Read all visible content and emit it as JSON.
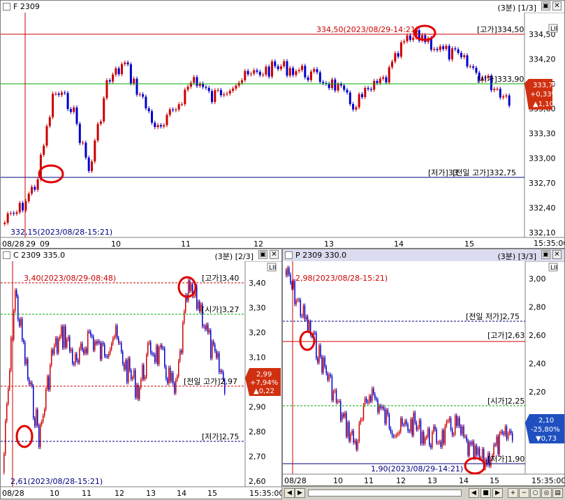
{
  "panels": {
    "F": {
      "title": "F 2309",
      "timeframe": "(3분)",
      "page": "[1/3]",
      "yticks": [
        "334,50",
        "334,20",
        "333,90",
        "333,60",
        "333,30",
        "333,00",
        "332,70",
        "332,40",
        "332,10"
      ],
      "xticks": [
        "08/28",
        "29",
        "09",
        "10",
        "11",
        "12",
        "13",
        "14",
        "15"
      ],
      "time": "15:35:00",
      "high_note": "334,50(2023/08/29-14:21)",
      "low_note": "332,15(2023/08/28-15:21)",
      "hline_high": "[고가]334,50",
      "hline_open": "[시가]333,90",
      "hline_low": "[저가]33",
      "hline_prev": "[전일 고가]332,75",
      "price_tag": [
        "333,75",
        "+0,33%",
        "▲1,10"
      ]
    },
    "C": {
      "title": "C 2309 335.0",
      "timeframe": "(3분)",
      "page": "[2/3]",
      "yticks": [
        "3,40",
        "3,30",
        "3,20",
        "3,10",
        "3,00",
        "2,90",
        "2,80",
        "2,70",
        "2,60"
      ],
      "xticks": [
        "08/28",
        "10",
        "11",
        "12",
        "13",
        "14",
        "15"
      ],
      "time": "15:35:00",
      "high_note": "3,40(2023/08/29-08:48)",
      "low_note": "2,61(2023/08/28-15:21)",
      "hline_high": "[고가]3,40",
      "hline_open": "[시가]3,27",
      "hline_prev": "[전일 고가]2,97",
      "hline_low": "[저가]2,75",
      "price_tag": [
        "2,99",
        "+7,94%",
        "▲0,22"
      ]
    },
    "P": {
      "title": "P 2309 330.0",
      "timeframe": "(3분)",
      "page": "[3/3]",
      "yticks": [
        "3,00",
        "2,80",
        "2,60",
        "2,40",
        "2,20",
        "2,00"
      ],
      "xticks": [
        "08/28",
        "10",
        "11",
        "12",
        "13",
        "14",
        "15"
      ],
      "time": "15:35:00",
      "high_note": "2,98(2023/08/28-15:21)",
      "low_note": "1,90(2023/08/29-14:21)",
      "hline_prevlow": "[전일 저가]2,75",
      "hline_high": "[고가]2,63",
      "hline_open": "[시가]2,25",
      "hline_low": "[저가]1,90",
      "price_tag": [
        "2,10",
        "-25,80%",
        "▼0,73"
      ]
    }
  },
  "colors": {
    "up": "#cc0000",
    "down": "#0000cc",
    "hline_red": "#cc0000",
    "hline_green": "#00aa00",
    "hline_navy": "#000080",
    "tag_red": "#d03010",
    "tag_blue": "#2050c0"
  }
}
